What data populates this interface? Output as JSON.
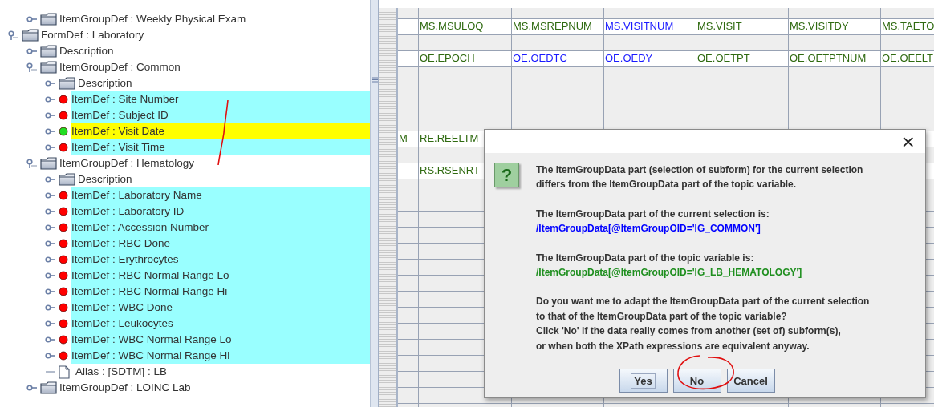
{
  "tree": {
    "scrolled_children": [
      {
        "kind": "group",
        "label": "ItemGroupDef : Weekly Physical Exam",
        "expanded": false
      }
    ],
    "roots": [
      {
        "kind": "group",
        "label": "FormDef : Laboratory",
        "expanded": true,
        "children": [
          {
            "kind": "group",
            "label": "Description",
            "expanded": false
          },
          {
            "kind": "group",
            "label": "ItemGroupDef : Common",
            "expanded": true,
            "children": [
              {
                "kind": "group",
                "label": "Description",
                "expanded": false
              },
              {
                "kind": "item",
                "label": "ItemDef : Site Number",
                "color": "#ff0000",
                "matched": true,
                "selected": false
              },
              {
                "kind": "item",
                "label": "ItemDef : Subject ID",
                "color": "#ff0000",
                "matched": true,
                "selected": false
              },
              {
                "kind": "item",
                "label": "ItemDef : Visit Date",
                "color": "#22dd22",
                "matched": true,
                "selected": true
              },
              {
                "kind": "item",
                "label": "ItemDef : Visit Time",
                "color": "#ff0000",
                "matched": true,
                "selected": false
              }
            ]
          },
          {
            "kind": "group",
            "label": "ItemGroupDef : Hematology",
            "expanded": true,
            "children": [
              {
                "kind": "group",
                "label": "Description",
                "expanded": false
              },
              {
                "kind": "item",
                "label": "ItemDef : Laboratory Name",
                "color": "#ff0000",
                "matched": true,
                "selected": false
              },
              {
                "kind": "item",
                "label": "ItemDef : Laboratory ID",
                "color": "#ff0000",
                "matched": true,
                "selected": false
              },
              {
                "kind": "item",
                "label": "ItemDef : Accession Number",
                "color": "#ff0000",
                "matched": true,
                "selected": false
              },
              {
                "kind": "item",
                "label": "ItemDef : RBC Done",
                "color": "#ff0000",
                "matched": true,
                "selected": false
              },
              {
                "kind": "item",
                "label": "ItemDef : Erythrocytes",
                "color": "#ff0000",
                "matched": true,
                "selected": false
              },
              {
                "kind": "item",
                "label": "ItemDef : RBC Normal Range Lo",
                "color": "#ff0000",
                "matched": true,
                "selected": false
              },
              {
                "kind": "item",
                "label": "ItemDef : RBC Normal Range Hi",
                "color": "#ff0000",
                "matched": true,
                "selected": false
              },
              {
                "kind": "item",
                "label": "ItemDef : WBC Done",
                "color": "#ff0000",
                "matched": true,
                "selected": false
              },
              {
                "kind": "item",
                "label": "ItemDef : Leukocytes",
                "color": "#ff0000",
                "matched": true,
                "selected": false
              },
              {
                "kind": "item",
                "label": "ItemDef : WBC Normal Range Lo",
                "color": "#ff0000",
                "matched": true,
                "selected": false
              },
              {
                "kind": "item",
                "label": "ItemDef : WBC Normal Range Hi",
                "color": "#ff0000",
                "matched": true,
                "selected": false
              },
              {
                "kind": "alias",
                "label": "Alias : [SDTM] : LB"
              }
            ]
          },
          {
            "kind": "group",
            "label": "ItemGroupDef : LOINC Lab",
            "expanded": false
          }
        ]
      }
    ]
  },
  "grid": {
    "rows": [
      {
        "kind": "blank"
      },
      {
        "kind": "data",
        "cells": [
          {
            "text": "MS.MSULOQ",
            "color": "#2f6a10"
          },
          {
            "text": "MS.MSREPNUM",
            "color": "#2f6a10"
          },
          {
            "text": "MS.VISITNUM",
            "color": "#1a1aff"
          },
          {
            "text": "MS.VISIT",
            "color": "#2f6a10"
          },
          {
            "text": "MS.VISITDY",
            "color": "#2f6a10"
          },
          {
            "text": "MS.TAETO",
            "color": "#2f6a10"
          }
        ]
      },
      {
        "kind": "blank"
      },
      {
        "kind": "data",
        "cells": [
          {
            "text": "OE.EPOCH",
            "color": "#2f6a10"
          },
          {
            "text": "OE.OEDTC",
            "color": "#1a1aff"
          },
          {
            "text": "OE.OEDY",
            "color": "#1a1aff"
          },
          {
            "text": "OE.OETPT",
            "color": "#2f6a10"
          },
          {
            "text": "OE.OETPTNUM",
            "color": "#2f6a10"
          },
          {
            "text": "OE.OEELT",
            "color": "#2f6a10"
          }
        ]
      },
      {
        "kind": "blank"
      },
      {
        "kind": "blank"
      },
      {
        "kind": "blank"
      },
      {
        "kind": "blank"
      },
      {
        "kind": "data",
        "lead": "M",
        "cells": [
          {
            "text": "RE.REELTM",
            "color": "#2f6a10"
          }
        ]
      },
      {
        "kind": "blank"
      },
      {
        "kind": "data",
        "cells": [
          {
            "text": "RS.RSENRT",
            "color": "#2f6a10"
          }
        ]
      },
      {
        "kind": "blank"
      },
      {
        "kind": "blank"
      },
      {
        "kind": "blank"
      },
      {
        "kind": "blank"
      },
      {
        "kind": "blank"
      },
      {
        "kind": "blank"
      },
      {
        "kind": "blank"
      },
      {
        "kind": "blank"
      },
      {
        "kind": "blank"
      },
      {
        "kind": "blank"
      },
      {
        "kind": "blank"
      },
      {
        "kind": "blank"
      },
      {
        "kind": "blank"
      },
      {
        "kind": "blank"
      },
      {
        "kind": "blank"
      },
      {
        "kind": "blank"
      },
      {
        "kind": "blank"
      }
    ]
  },
  "dialog": {
    "close": "×",
    "icon": "?",
    "paragraphs": [
      [
        {
          "kind": "text",
          "text": "The ItemGroupData part (selection of subform) for the current selection"
        },
        {
          "kind": "text",
          "text": "differs from the ItemGroupData part of the topic variable."
        }
      ],
      [
        {
          "kind": "text",
          "text": "The ItemGroupData part of the current selection is:"
        },
        {
          "kind": "path",
          "color": "#0000ff",
          "text": "/ItemGroupData[@ItemGroupOID='IG_COMMON']"
        }
      ],
      [
        {
          "kind": "text",
          "text": "The ItemGroupData part of the topic variable is:"
        },
        {
          "kind": "path",
          "color": "#1f8f1f",
          "text": "/ItemGroupData[@ItemGroupOID='IG_LB_HEMATOLOGY']"
        }
      ],
      [
        {
          "kind": "text",
          "text": "Do you want me to adapt the ItemGroupData part of the current selection"
        },
        {
          "kind": "text",
          "text": "to that of the ItemGroupData part of the topic variable?"
        },
        {
          "kind": "text",
          "text": "Click 'No' if the data really comes from another (set of) subform(s),"
        },
        {
          "kind": "text",
          "text": "or when both the XPath expressions are equivalent anyway."
        }
      ]
    ],
    "buttons": [
      {
        "label": "Yes",
        "focused": true
      },
      {
        "label": "No",
        "focused": false
      },
      {
        "label": "Cancel",
        "focused": false
      }
    ]
  }
}
